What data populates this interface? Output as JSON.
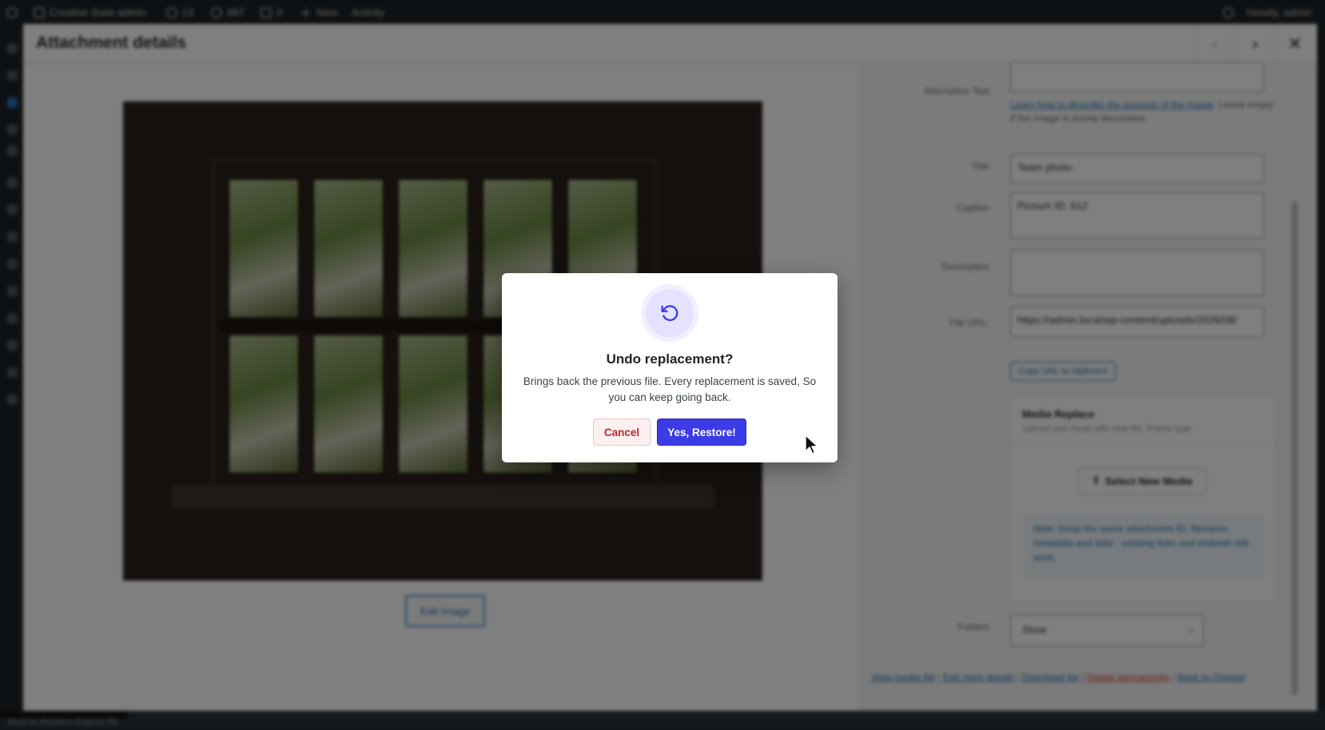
{
  "admin_bar": {
    "site_name": "Creative Suite admin",
    "updates_count": "13",
    "search_count": "997",
    "comments_count": "0",
    "new_label": "New",
    "activity_label": "Activity",
    "user_label": "Howdy, admin"
  },
  "modal": {
    "title": "Attachment details",
    "edit_image_label": "Edit Image"
  },
  "settings": {
    "alt_text_label": "Alternative Text",
    "alt_help_link": "Learn how to describe the purpose of the image",
    "alt_help_rest": ". Leave empty if the image is purely decorative.",
    "title_label": "Title",
    "title_value": "Team photo",
    "caption_label": "Caption",
    "caption_value": "Picsum ID: 612",
    "description_label": "Description",
    "description_value": "",
    "file_url_label": "File URL:",
    "file_url_value": "https://admin.local/wp-content/uploads/2026/08/",
    "copy_url_label": "Copy URL to clipboard"
  },
  "media_replace": {
    "title": "Media Replace",
    "subtitle": "Upload and Swap with new file. Frame type",
    "select_label": "Select New Media",
    "note": "Note: Keep the same attachment ID, filename, metadata and date - existing links and embeds still work."
  },
  "folders": {
    "label": "Folders",
    "selected": "Shoe"
  },
  "footer_links": {
    "view": "View media file",
    "edit": "Edit more details",
    "download": "Download file",
    "delete": "Delete permanently",
    "back": "Back to Original"
  },
  "bottom_status": "Back to Replace Original file",
  "dialog": {
    "title": "Undo replacement?",
    "description": "Brings back the previous file. Every replacement is saved, So you can keep going back.",
    "cancel_label": "Cancel",
    "confirm_label": "Yes, Restore!",
    "accent_color": "#3c3ce6",
    "cancel_color": "#b32d2e"
  }
}
